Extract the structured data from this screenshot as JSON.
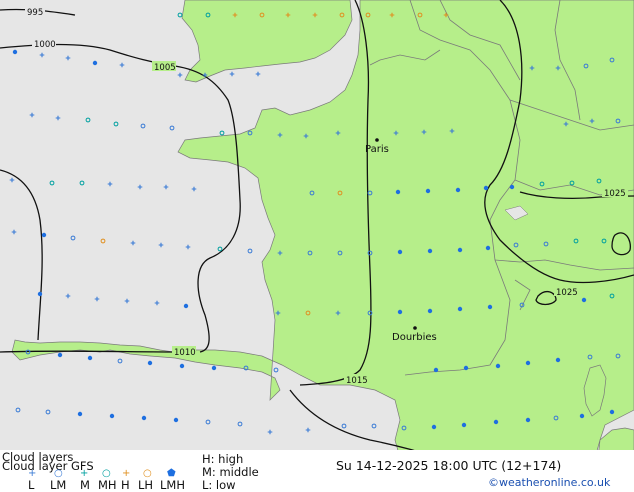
{
  "map": {
    "colors": {
      "sea": "#e6e6e6",
      "land": "#b6ee8a",
      "border": "#7a7a7a",
      "isobar": "#111111"
    },
    "cities": [
      {
        "name": "Paris"
      },
      {
        "name": "Dourbies"
      }
    ],
    "isobars": [
      "995",
      "1000",
      "1005",
      "1010",
      "1015",
      "1025",
      "1025"
    ]
  },
  "legend": {
    "title": "Cloud layers",
    "model_line": "Cloud layer  GFS",
    "symbols": [
      {
        "glyph": "+",
        "color": "#3a7bd5",
        "label": "L"
      },
      {
        "glyph": "○",
        "color": "#3a7bd5",
        "label": "LM"
      },
      {
        "glyph": "+",
        "color": "#00a0a0",
        "label": "M"
      },
      {
        "glyph": "○",
        "color": "#00a0a0",
        "label": "MH"
      },
      {
        "glyph": "+",
        "color": "#e09020",
        "label": "H"
      },
      {
        "glyph": "○",
        "color": "#e09020",
        "label": "LH"
      },
      {
        "glyph": "⬟",
        "color": "#1e6fe0",
        "label": "LMH"
      }
    ],
    "high": "H: high",
    "middle": "M: middle",
    "low": "L: low",
    "datetime": "Su 14-12-2025 18:00 UTC (12+174)",
    "credit": "©weatheronline.co.uk"
  }
}
